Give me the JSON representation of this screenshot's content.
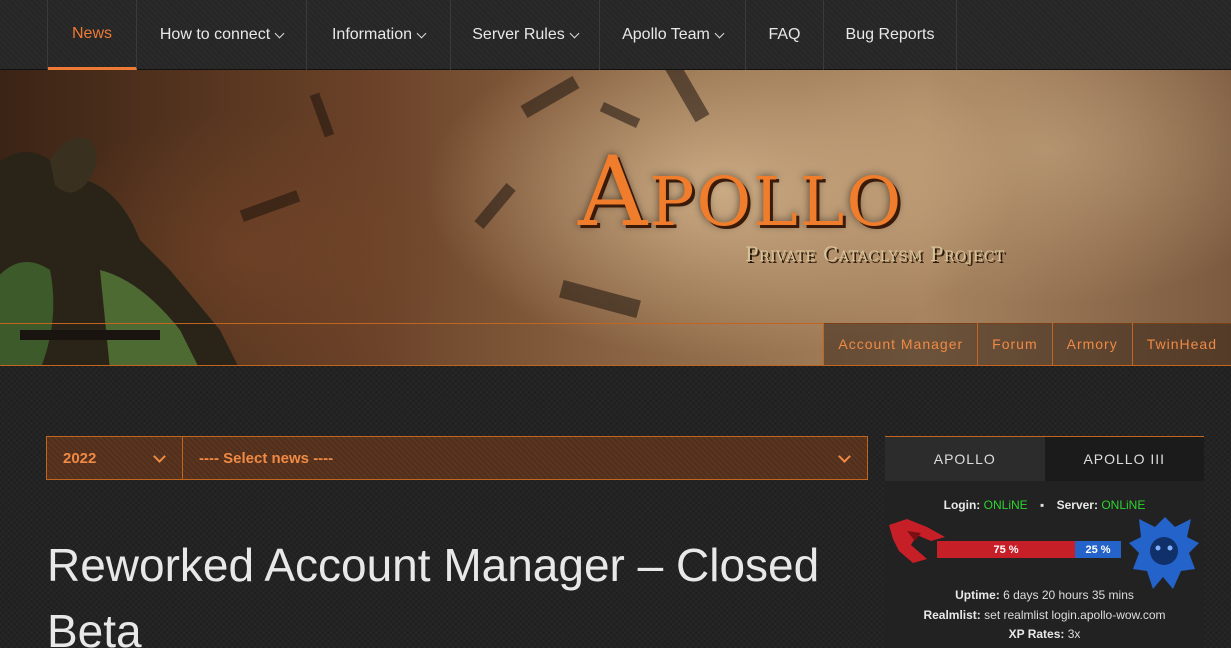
{
  "nav": {
    "items": [
      {
        "label": "News",
        "dropdown": false
      },
      {
        "label": "How to connect",
        "dropdown": true
      },
      {
        "label": "Information",
        "dropdown": true
      },
      {
        "label": "Server Rules",
        "dropdown": true
      },
      {
        "label": "Apollo Team",
        "dropdown": true
      },
      {
        "label": "FAQ",
        "dropdown": false
      },
      {
        "label": "Bug Reports",
        "dropdown": false
      }
    ],
    "active_color": "#ee7a35"
  },
  "banner": {
    "title": "Apollo",
    "subtitle": "Private Cataclysm Project",
    "links": [
      "Account Manager",
      "Forum",
      "Armory",
      "TwinHead"
    ]
  },
  "news_select": {
    "year": "2022",
    "news": "---- Select news ----"
  },
  "article": {
    "title": "Reworked Account Manager – Closed Beta"
  },
  "server_panel": {
    "tabs": [
      "APOLLO",
      "APOLLO III"
    ],
    "login_label": "Login:",
    "login_status": "ONLiNE",
    "server_label": "Server:",
    "server_status": "ONLiNE",
    "horde_percent": "75 %",
    "alliance_percent": "25 %",
    "horde_fraction": 0.75,
    "alliance_fraction": 0.25,
    "uptime_label": "Uptime:",
    "uptime_value": "6 days 20 hours 35 mins",
    "realmlist_label": "Realmlist:",
    "realmlist_value": "set realmlist login.apollo-wow.com",
    "xp_label": "XP Rates:",
    "xp_value": "3x",
    "colors": {
      "online": "#2fd12f",
      "horde": "#c71f27",
      "alliance": "#2463c9",
      "accent": "#c2651f"
    }
  }
}
